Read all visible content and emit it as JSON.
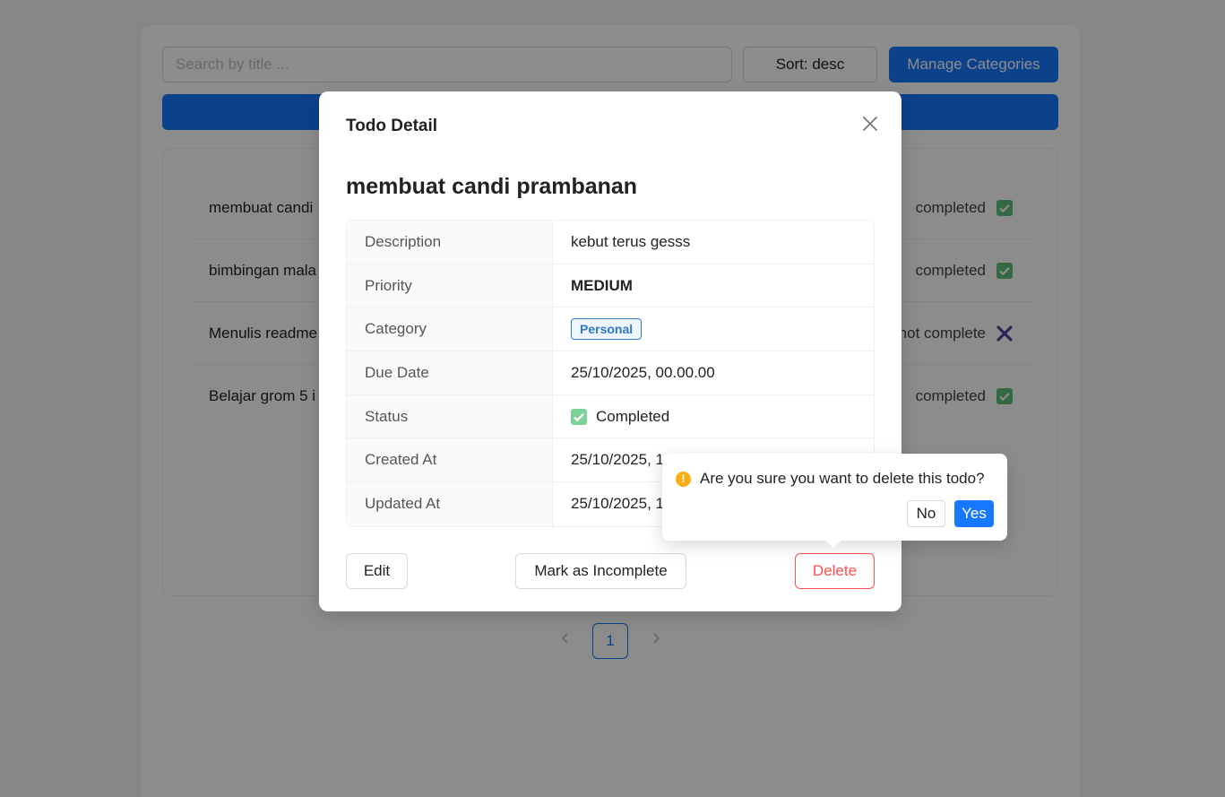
{
  "toolbar": {
    "search_placeholder": "Search by title ...",
    "sort_label": "Sort: desc",
    "manage_label": "Manage Categories"
  },
  "todos": [
    {
      "title": "membuat candi",
      "status": "completed",
      "done": true
    },
    {
      "title": "bimbingan mala",
      "status": "completed",
      "done": true
    },
    {
      "title": "Menulis readme",
      "status": "not complete",
      "done": false
    },
    {
      "title": "Belajar grom 5 i",
      "status": "completed",
      "done": true
    }
  ],
  "pagination": {
    "prev_icon": "chevron-left-icon",
    "current_page": "1",
    "next_icon": "chevron-right-icon"
  },
  "modal": {
    "title": "Todo Detail",
    "close_icon": "close-icon",
    "todo_title": "membuat candi prambanan",
    "details": [
      {
        "label": "Description",
        "value": "kebut terus gesss"
      },
      {
        "label": "Priority",
        "value": "MEDIUM"
      },
      {
        "label": "Category",
        "value": "Personal"
      },
      {
        "label": "Due Date",
        "value": "25/10/2025, 00.00.00"
      },
      {
        "label": "Status",
        "value": "Completed"
      },
      {
        "label": "Created At",
        "value": "25/10/2025, 1"
      },
      {
        "label": "Updated At",
        "value": "25/10/2025, 1"
      }
    ],
    "edit_label": "Edit",
    "incomplete_label": "Mark as Incomplete",
    "delete_label": "Delete"
  },
  "popconfirm": {
    "icon": "warning-icon",
    "message": "Are you sure you want to delete this todo?",
    "no_label": "No",
    "yes_label": "Yes"
  },
  "colors": {
    "primary": "#1677ff",
    "danger": "#ff4d4f",
    "success": "#52c41a",
    "warning": "#faad14",
    "incomplete": "#5b3fa0"
  }
}
